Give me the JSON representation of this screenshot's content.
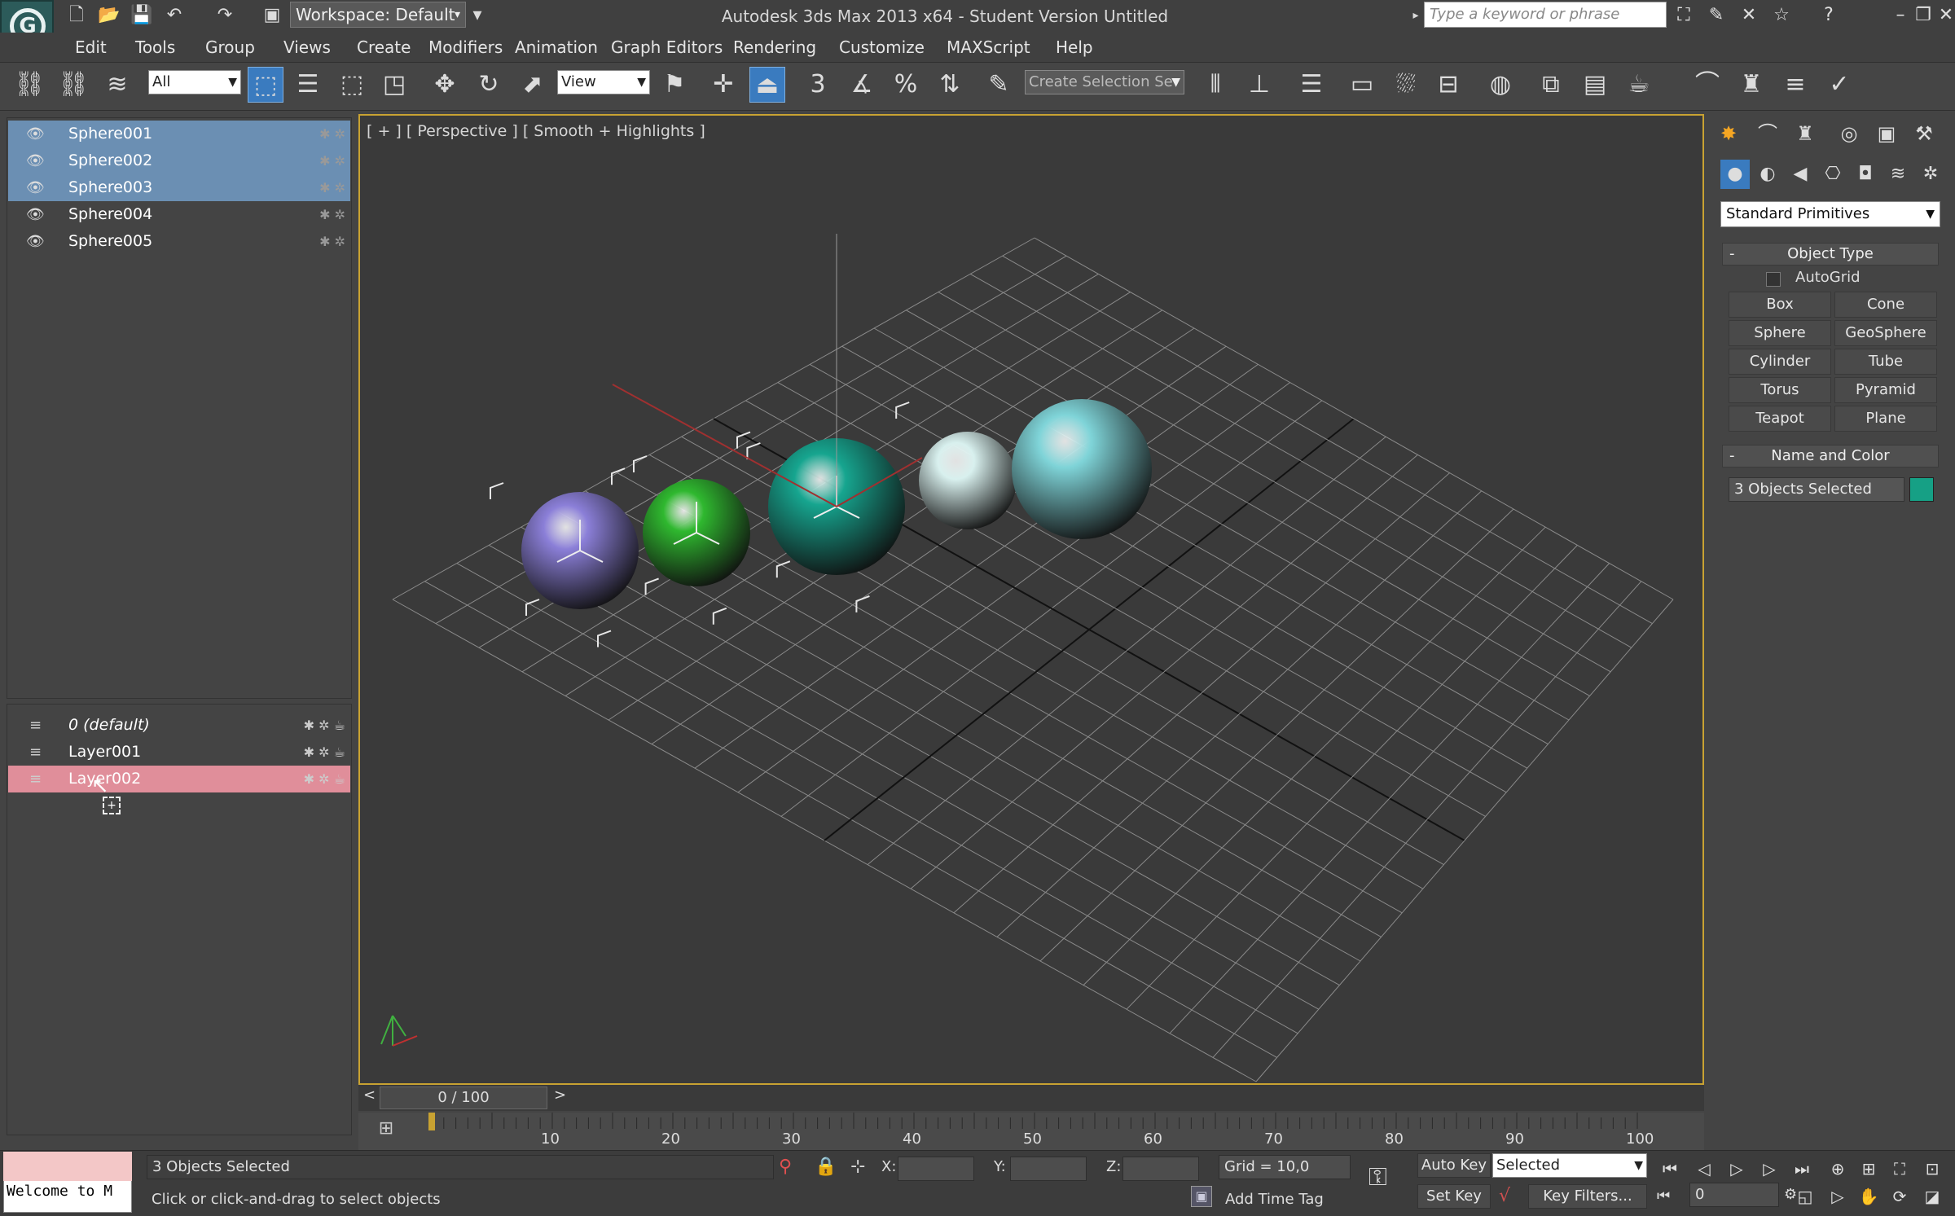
{
  "title_bar": {
    "workspace": "Workspace: Default",
    "title": "Autodesk 3ds Max  2013 x64   - Student Version   Untitled",
    "search_placeholder": "Type a keyword or phrase"
  },
  "menu": [
    "Edit",
    "Tools",
    "Group",
    "Views",
    "Create",
    "Modifiers",
    "Animation",
    "Graph Editors",
    "Rendering",
    "Customize",
    "MAXScript",
    "Help"
  ],
  "toolbar": {
    "filter": "All",
    "ref_coord": "View",
    "selection_set": "Create Selection Se"
  },
  "scene_explorer": {
    "objects": [
      {
        "name": "Sphere001",
        "selected": true
      },
      {
        "name": "Sphere002",
        "selected": true
      },
      {
        "name": "Sphere003",
        "selected": true
      },
      {
        "name": "Sphere004",
        "selected": false
      },
      {
        "name": "Sphere005",
        "selected": false
      }
    ]
  },
  "layer_explorer": {
    "layers": [
      {
        "name": "0 (default)",
        "highlighted": false
      },
      {
        "name": "Layer001",
        "highlighted": false
      },
      {
        "name": "Layer002",
        "highlighted": true
      }
    ]
  },
  "viewport": {
    "label": "[ + ] [ Perspective ] [ Smooth + Highlights ]",
    "spheres": [
      {
        "color": "#8b7fd8"
      },
      {
        "color": "#2fb82f"
      },
      {
        "color": "#16a58f"
      },
      {
        "color": "#d8f0ee"
      },
      {
        "color": "#7fd4d8"
      }
    ]
  },
  "command_panel": {
    "category": "Standard Primitives",
    "object_type_title": "Object Type",
    "autogrid_label": "AutoGrid",
    "buttons": [
      "Box",
      "Cone",
      "Sphere",
      "GeoSphere",
      "Cylinder",
      "Tube",
      "Torus",
      "Pyramid",
      "Teapot",
      "Plane"
    ],
    "name_color_title": "Name and Color",
    "name_value": "3 Objects Selected",
    "object_color": "#16a085"
  },
  "timeline": {
    "frame": "0 / 100",
    "ticks": [
      "10",
      "20",
      "30",
      "40",
      "50",
      "60",
      "70",
      "80",
      "90",
      "100"
    ]
  },
  "status_bar": {
    "maxscript_text": "Welcome to M",
    "selection_status": "3 Objects Selected",
    "prompt": "Click or click-and-drag to select objects",
    "x_label": "X:",
    "y_label": "Y:",
    "z_label": "Z:",
    "grid": "Grid = 10,0",
    "add_time_tag": "Add Time Tag",
    "auto_key": "Auto Key",
    "set_key": "Set Key",
    "key_mode": "Selected",
    "key_filters": "Key Filters...",
    "current_frame": "0"
  }
}
